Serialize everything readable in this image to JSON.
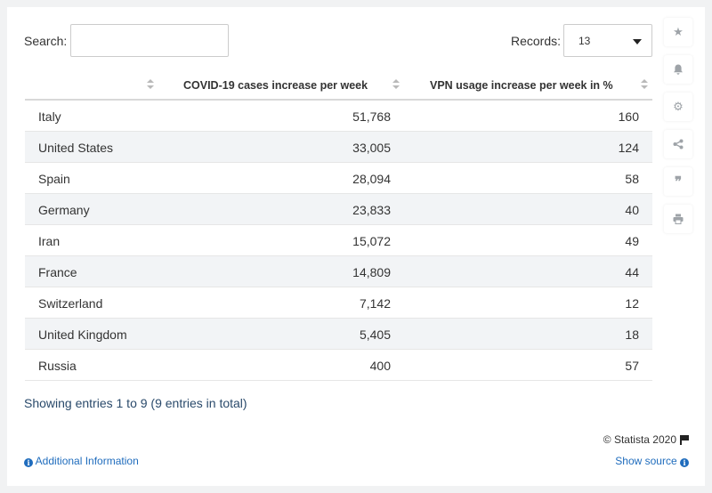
{
  "controls": {
    "search_label": "Search:",
    "search_value": "",
    "records_label": "Records:",
    "records_value": "13"
  },
  "table": {
    "headers": [
      "",
      "COVID-19 cases increase per week",
      "VPN usage increase per week in %"
    ],
    "rows": [
      [
        "Italy",
        "51,768",
        "160"
      ],
      [
        "United States",
        "33,005",
        "124"
      ],
      [
        "Spain",
        "28,094",
        "58"
      ],
      [
        "Germany",
        "23,833",
        "40"
      ],
      [
        "Iran",
        "15,072",
        "49"
      ],
      [
        "France",
        "14,809",
        "44"
      ],
      [
        "Switzerland",
        "7,142",
        "12"
      ],
      [
        "United Kingdom",
        "5,405",
        "18"
      ],
      [
        "Russia",
        "400",
        "57"
      ]
    ]
  },
  "footer": {
    "entries_text": "Showing entries 1 to 9 (9 entries in total)",
    "copyright": "© Statista 2020",
    "additional_info": "Additional Information",
    "show_source": "Show source"
  },
  "sidebar_icons": [
    "star-icon",
    "bell-icon",
    "gear-icon",
    "share-icon",
    "quote-icon",
    "print-icon"
  ]
}
